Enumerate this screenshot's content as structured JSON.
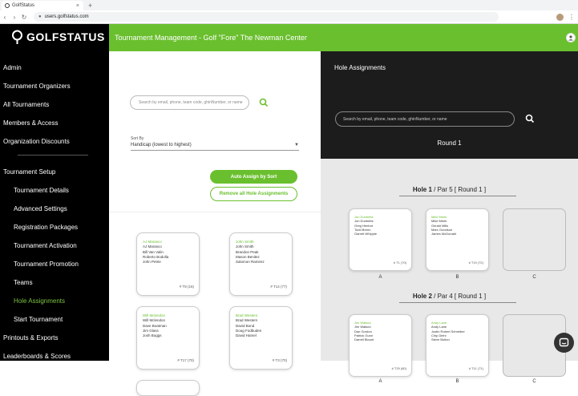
{
  "browser": {
    "tab_title": "GolfStatus",
    "tab_close": "×",
    "new_tab": "+",
    "nav_back": "‹",
    "nav_forward": "›",
    "nav_reload": "↻",
    "url": "users.golfstatus.com",
    "menu": "⋮"
  },
  "sidebar": {
    "brand": "GOLFSTATUS",
    "items": [
      {
        "label": "Admin"
      },
      {
        "label": "Tournament Organizers"
      },
      {
        "label": "All Tournaments"
      },
      {
        "label": "Members & Access"
      },
      {
        "label": "Organization Discounts"
      },
      {
        "label": "Tournament Setup"
      },
      {
        "label": "Tournament Details"
      },
      {
        "label": "Advanced Settings"
      },
      {
        "label": "Registration Packages"
      },
      {
        "label": "Tournament Activation"
      },
      {
        "label": "Tournament Promotion"
      },
      {
        "label": "Teams"
      },
      {
        "label": "Hole Assignments"
      },
      {
        "label": "Start Tournament"
      },
      {
        "label": "Printouts & Exports"
      },
      {
        "label": "Leaderboards & Scores"
      }
    ]
  },
  "header": {
    "title": "Tournament Management - Golf \"Fore\" The Newman Center"
  },
  "left_panel": {
    "search_placeholder": "Search by email, phone, team code, ghinNumber, or name",
    "sort_label": "Sort By",
    "sort_value": "Handicap (lowest to highest)",
    "auto_assign_label": "Auto Assign by Sort",
    "remove_all_label": "Remove all Hole Assignments",
    "teams": [
      {
        "names": [
          "AJ Marasco",
          "AJ Marasco",
          "Bill Van Valin",
          "Roberto Bodolla",
          "John Petrie"
        ],
        "code": "# T8 (16)"
      },
      {
        "names": [
          "John Smith",
          "John Smith",
          "Brandon Peak",
          "Mason Benitez",
          "Salomon Ramirez"
        ],
        "code": "# T14 (77)"
      },
      {
        "names": [
          "Will Mclendon",
          "Will Mclendon",
          "Dave Boatman",
          "Jim Glass",
          "Josh Boggs"
        ],
        "code": "# T17 (70)"
      },
      {
        "names": [
          "Brad Western",
          "Brad Western",
          "David Bond",
          "Doug Fodbuden",
          "David Hamel"
        ],
        "code": "# T3 (70)"
      }
    ]
  },
  "right_panel": {
    "title": "Hole Assignments",
    "search_placeholder": "Search by email, phone, team code, ghinNumber, or name",
    "round": "Round 1",
    "holes": [
      {
        "hole_label": "Hole 1",
        "detail": " / Par 5 [ Round 1 ]",
        "slots": [
          {
            "letter": "A",
            "names": [
              "Jon Dunbetts",
              "Jon Dunbetts",
              "Greg Henbot",
              "Todd Brenn",
              "Garrett Whipple"
            ],
            "code": "# T1 (70)"
          },
          {
            "letter": "B",
            "names": [
              "Mike Meek",
              "Mike Meek",
              "Gerald Mills",
              "Marc Goodson",
              "James McDonald"
            ],
            "code": "# T19 (72)"
          },
          {
            "letter": "C",
            "names": [],
            "code": ""
          }
        ]
      },
      {
        "hole_label": "Hole 2",
        "detail": " / Par 4 [ Round 1 ]",
        "slots": [
          {
            "letter": "A",
            "names": [
              "Jim Watson",
              "Jim Watson",
              "Dan Gordon",
              "Patrick Gunn",
              "Darrell Blount"
            ],
            "code": "# T29 (80)"
          },
          {
            "letter": "B",
            "names": [
              "Andy Lane",
              "Andy Lane",
              "Justin Robert Schreiber",
              "Chip Diehl",
              "Steve Bolton"
            ],
            "code": "# T11 (71)"
          },
          {
            "letter": "C",
            "names": [],
            "code": ""
          }
        ]
      }
    ]
  }
}
